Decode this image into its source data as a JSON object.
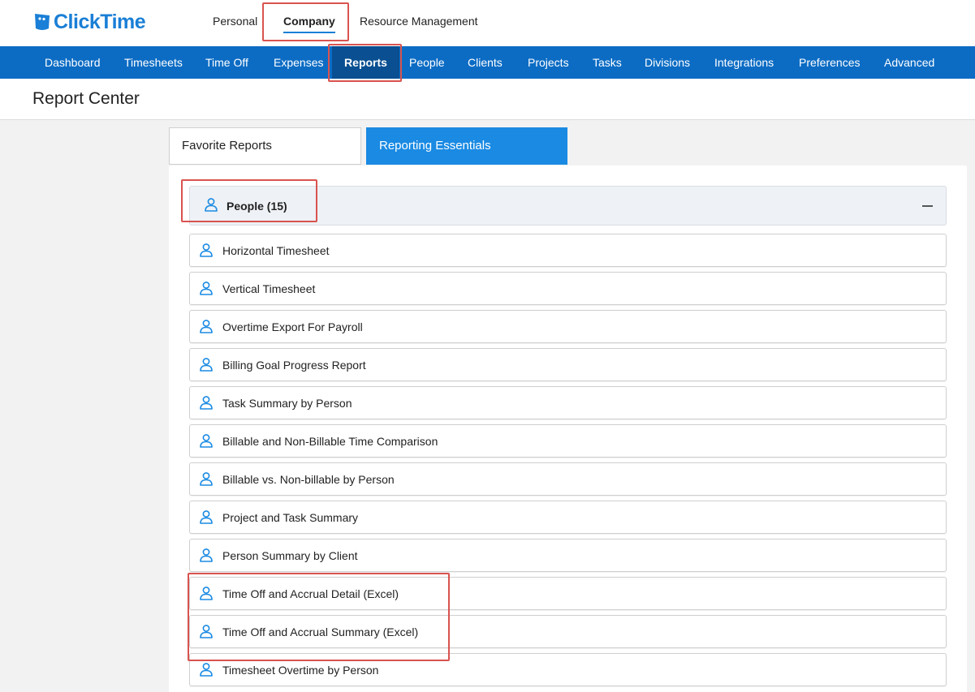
{
  "app": {
    "brand": "ClickTime",
    "brand_color": "#1a7fd6"
  },
  "top_tabs": [
    {
      "label": "Personal"
    },
    {
      "label": "Company",
      "active": true
    },
    {
      "label": "Resource Management"
    }
  ],
  "nav": {
    "items": [
      {
        "label": "Dashboard"
      },
      {
        "label": "Timesheets"
      },
      {
        "label": "Time Off"
      },
      {
        "label": "Expenses"
      },
      {
        "label": "Reports",
        "active": true
      },
      {
        "label": "People"
      },
      {
        "label": "Clients"
      },
      {
        "label": "Projects"
      },
      {
        "label": "Tasks"
      },
      {
        "label": "Divisions"
      },
      {
        "label": "Integrations"
      },
      {
        "label": "Preferences"
      },
      {
        "label": "Advanced"
      }
    ],
    "bar_color": "#0c6cc4",
    "active_color": "#094f91"
  },
  "page": {
    "title": "Report Center"
  },
  "tabs": [
    {
      "label": "Favorite Reports",
      "active": false
    },
    {
      "label": "Reporting Essentials",
      "active": true
    }
  ],
  "group": {
    "label": "People (15)",
    "icon": "person-icon",
    "expanded": true
  },
  "reports": [
    {
      "label": "Horizontal Timesheet"
    },
    {
      "label": "Vertical Timesheet"
    },
    {
      "label": "Overtime Export For Payroll"
    },
    {
      "label": "Billing Goal Progress Report"
    },
    {
      "label": "Task Summary by Person"
    },
    {
      "label": "Billable and Non-Billable Time Comparison"
    },
    {
      "label": "Billable vs. Non-billable by Person"
    },
    {
      "label": "Project and Task Summary"
    },
    {
      "label": "Person Summary by Client"
    },
    {
      "label": "Time Off and Accrual Detail (Excel)"
    },
    {
      "label": "Time Off and Accrual Summary (Excel)"
    },
    {
      "label": "Timesheet Overtime by Person"
    }
  ],
  "highlight_color": "#d9534f"
}
